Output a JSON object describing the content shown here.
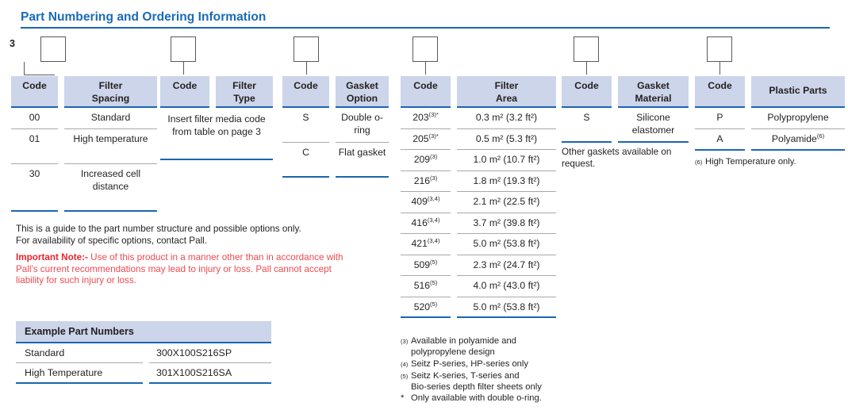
{
  "header": {
    "title": "Part Numbering and Ordering Information"
  },
  "lead_digit": "3",
  "groups": [
    {
      "id": "filter-spacing",
      "code_header": "Code",
      "value_header_line1": "Filter",
      "value_header_line2": "Spacing",
      "rows": [
        {
          "code": "00",
          "value": "Standard"
        },
        {
          "code": "01",
          "value": "High temperature"
        },
        {
          "code": "30",
          "value": "Increased cell distance"
        }
      ]
    },
    {
      "id": "filter-type",
      "code_header": "Code",
      "value_header_line1": "Filter",
      "value_header_line2": "Type",
      "merged_text": "Insert filter media code from table on page 3"
    },
    {
      "id": "gasket-option",
      "code_header": "Code",
      "value_header_line1": "Gasket",
      "value_header_line2": "Option",
      "rows": [
        {
          "code": "S",
          "value": "Double o-ring"
        },
        {
          "code": "C",
          "value": "Flat gasket"
        }
      ]
    },
    {
      "id": "filter-area",
      "code_header": "Code",
      "value_header_line1": "Filter",
      "value_header_line2": "Area",
      "rows": [
        {
          "code": "203",
          "code_sup": "(3)*",
          "value": "0.3 m² (3.2 ft²)"
        },
        {
          "code": "205",
          "code_sup": "(3)*",
          "value": "0.5 m² (5.3 ft²)"
        },
        {
          "code": "209",
          "code_sup": "(3)",
          "value": "1.0 m² (10.7 ft²)"
        },
        {
          "code": "216",
          "code_sup": "(3)",
          "value": "1.8 m² (19.3 ft²)"
        },
        {
          "code": "409",
          "code_sup": "(3,4)",
          "value": "2.1 m² (22.5 ft²)"
        },
        {
          "code": "416",
          "code_sup": "(3,4)",
          "value": "3.7 m² (39.8 ft²)"
        },
        {
          "code": "421",
          "code_sup": "(3,4)",
          "value": "5.0 m² (53.8 ft²)"
        },
        {
          "code": "509",
          "code_sup": "(5)",
          "value": "2.3 m² (24.7 ft²)"
        },
        {
          "code": "516",
          "code_sup": "(5)",
          "value": "4.0 m² (43.0 ft²)"
        },
        {
          "code": "520",
          "code_sup": "(5)",
          "value": "5.0 m² (53.8 ft²)"
        }
      ]
    },
    {
      "id": "gasket-material",
      "code_header": "Code",
      "value_header_line1": "Gasket",
      "value_header_line2": "Material",
      "rows": [
        {
          "code": "S",
          "value": "Silicone elastomer"
        }
      ]
    },
    {
      "id": "plastic-parts",
      "code_header": "Code",
      "value_header_line1": "Plastic Parts",
      "value_header_line2": "",
      "rows": [
        {
          "code": "P",
          "value": "Polypropylene"
        },
        {
          "code": "A",
          "value": "Polyamide",
          "value_sup": "(6)"
        }
      ]
    }
  ],
  "guide_note": {
    "line1": "This is a guide to the part number structure and possible options only.",
    "line2": "For availability of specific options, contact Pall."
  },
  "important_note": {
    "label": "Important Note",
    "separator": ":-",
    "line1_rest": " Use of this product in a manner other than in accordance with",
    "line2": "Pall's current recommendations may lead to injury or loss. Pall cannot accept",
    "line3": "liability for such injury or loss."
  },
  "gasket_note": {
    "line1": "Other gaskets available on",
    "line2": "request."
  },
  "plastic_footnote": {
    "mark": "(6)",
    "text": "High Temperature only."
  },
  "area_footnotes": [
    {
      "mark": "(3)",
      "line1": "Available in polyamide and",
      "line2": "polypropylene design"
    },
    {
      "mark": "(4)",
      "line1": "Seitz P-series, HP-series only",
      "line2": ""
    },
    {
      "mark": "(5)",
      "line1": "Seitz K-series, T-series and",
      "line2": "Bio-series depth filter sheets only"
    },
    {
      "mark": "*",
      "line1": "Only available with double o-ring.",
      "line2": ""
    }
  ],
  "example_table": {
    "title": "Example Part Numbers",
    "rows": [
      {
        "label": "Standard",
        "part_number": "300X100S216SP"
      },
      {
        "label": "High Temperature",
        "part_number": "301X100S216SA"
      }
    ]
  },
  "colors": {
    "title_blue": "#1a6bb5",
    "rule_blue": "#1a66b0",
    "header_fill": "#ccd5e9",
    "note_red": "#ef4a52",
    "text": "#231f20",
    "thin_rule": "#a7a9ac",
    "box_stroke": "#58595b"
  }
}
